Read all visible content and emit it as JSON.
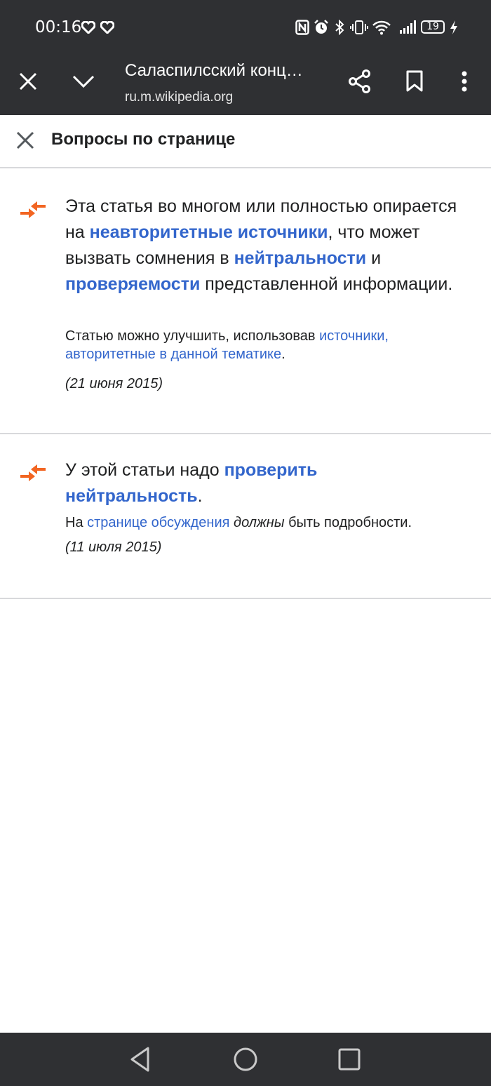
{
  "status_bar": {
    "time": "00:16",
    "battery": "19",
    "icons": [
      "heart-icon",
      "heart-icon",
      "nfc-icon",
      "alarm-icon",
      "bluetooth-icon",
      "vibrate-icon",
      "wifi-icon",
      "signal-icon",
      "battery-icon",
      "charging-icon"
    ]
  },
  "toolbar": {
    "title": "Саласпилсский конц…",
    "url": "ru.m.wikipedia.org",
    "icons": [
      "close-icon",
      "chevron-down-icon",
      "share-icon",
      "bookmark-icon",
      "more-vert-icon"
    ]
  },
  "sheet": {
    "title": "Вопросы по странице"
  },
  "issues": [
    {
      "icon": "issue-arrows-icon",
      "main_1": "Эта статья во многом или полностью опирается на ",
      "main_link_1": "неавторитетные источники",
      "main_2": ", что может вызвать сомнения в ",
      "main_link_2": "нейтральности",
      "main_3": " и ",
      "main_link_3": "проверяемости",
      "main_4": " представленной информации.",
      "sub_1": "Статью можно улучшить, использовав ",
      "sub_link": "источники, авторитетные в данной тематике",
      "sub_2": ".",
      "date": "(21 июня 2015)"
    },
    {
      "icon": "issue-arrows-icon",
      "main_1": "У этой статьи надо ",
      "main_link_1": "проверить нейтральность",
      "main_2": ".",
      "sub_1": "На ",
      "sub_link": "странице обсуждения",
      "sub_em": "должны",
      "sub_2": " быть подробности.",
      "date": "(11 июля 2015)"
    }
  ],
  "nav_bar": {
    "icons": [
      "back-icon",
      "home-icon",
      "recents-icon"
    ]
  },
  "colors": {
    "bar_bg": "#2f3033",
    "link": "#3366cc",
    "accent_orange": "#f26522",
    "divider": "#d8d9db"
  }
}
